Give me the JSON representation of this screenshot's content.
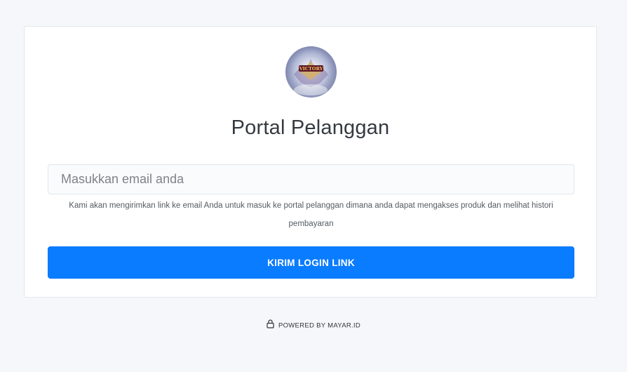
{
  "card": {
    "title": "Portal Pelanggan",
    "avatar_label": "VICTORY",
    "email": {
      "placeholder": "Masukkan email anda",
      "value": ""
    },
    "help_text": "Kami akan mengirimkan link ke email Anda untuk masuk ke portal pelanggan dimana anda dapat mengakses produk dan melihat histori pembayaran",
    "submit_label": "KIRIM LOGIN LINK"
  },
  "footer": {
    "icon": "lock-icon",
    "powered_by": "POWERED BY MAYAR.ID"
  },
  "colors": {
    "background": "#f6f7fa",
    "card": "#ffffff",
    "primary": "#0a7cff",
    "text": "#343a40"
  }
}
